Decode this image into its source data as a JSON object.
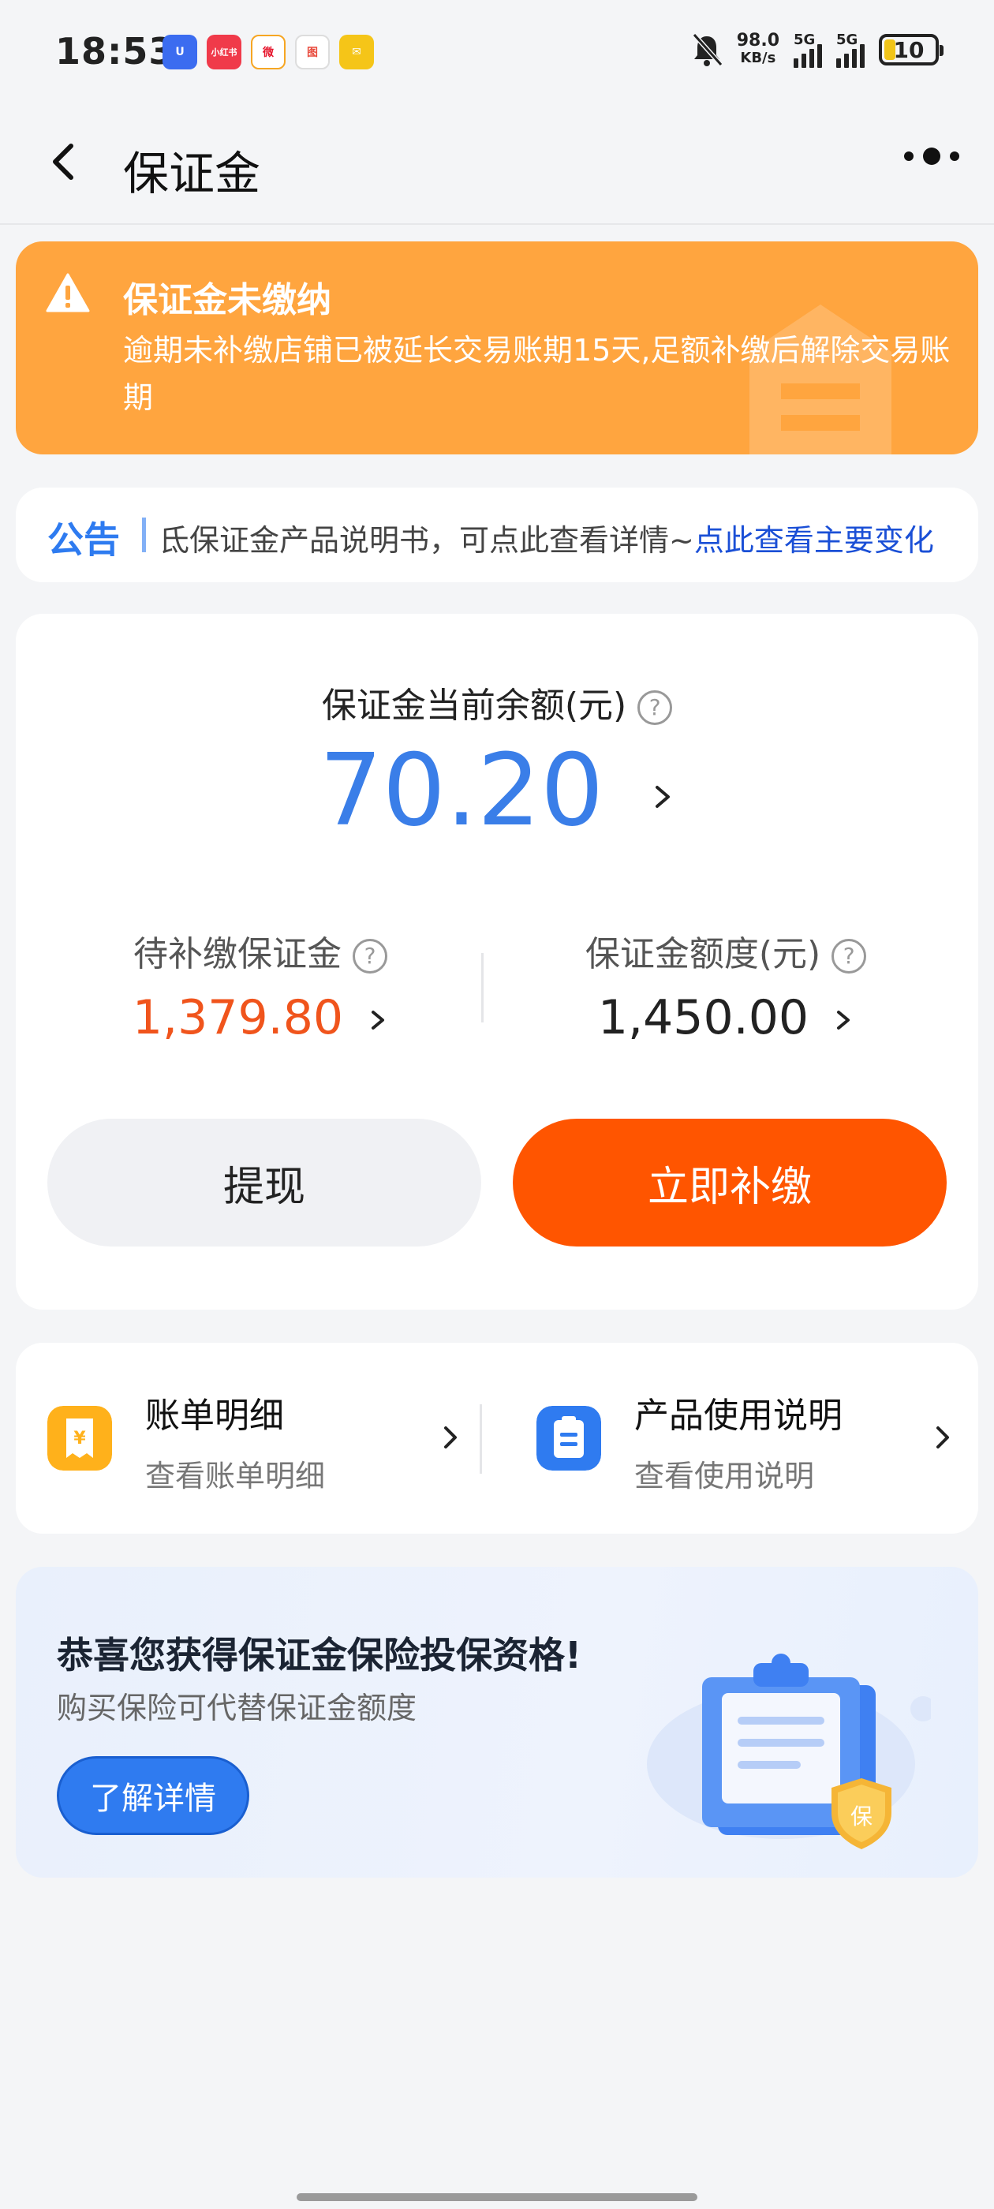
{
  "status_bar": {
    "time": "18:53",
    "net_speed_value": "98.0",
    "net_speed_unit": "KB/s",
    "sim1": "5G",
    "sim2": "5G",
    "battery": "10",
    "app_icons": [
      {
        "name": "taobao-u-icon",
        "label": "U",
        "color": "#3b6cf0"
      },
      {
        "name": "xiaohongshu-icon",
        "label": "小红书",
        "color": "#f03a4a"
      },
      {
        "name": "weibo-icon",
        "label": "微",
        "color": "#f6a623"
      },
      {
        "name": "maps-icon",
        "label": "图",
        "color": "#e84a3c"
      },
      {
        "name": "mail-icon",
        "label": "✉",
        "color": "#f5c518"
      }
    ]
  },
  "nav": {
    "title": "保证金"
  },
  "warning": {
    "title": "保证金未缴纳",
    "text": "逾期未补缴店铺已被延长交易账期15天,足额补缴后解除交易账期",
    "color": "#ffa53f"
  },
  "notice": {
    "label": "公告",
    "text": "氐保证金产品说明书，可点此查看详情~",
    "link": "点此查看主要变化"
  },
  "balance": {
    "label": "保证金当前余额(元)",
    "amount": "70.20",
    "pending_label": "待补缴保证金",
    "pending_value": "1,379.80",
    "quota_label": "保证金额度(元)",
    "quota_value": "1,450.00",
    "withdraw_label": "提现",
    "pay_label": "立即补缴",
    "accent_blue": "#3a7ee8",
    "accent_orange": "#ff5500"
  },
  "links": [
    {
      "title": "账单明细",
      "sub": "查看账单明细",
      "icon": "bill-icon",
      "color": "#ffb11b"
    },
    {
      "title": "产品使用说明",
      "sub": "查看使用说明",
      "icon": "clipboard-icon",
      "color": "#2f7bf0"
    }
  ],
  "insurance": {
    "title": "恭喜您获得保证金保险投保资格!",
    "sub": "购买保险可代替保证金额度",
    "button": "了解详情",
    "badge_text": "保"
  }
}
